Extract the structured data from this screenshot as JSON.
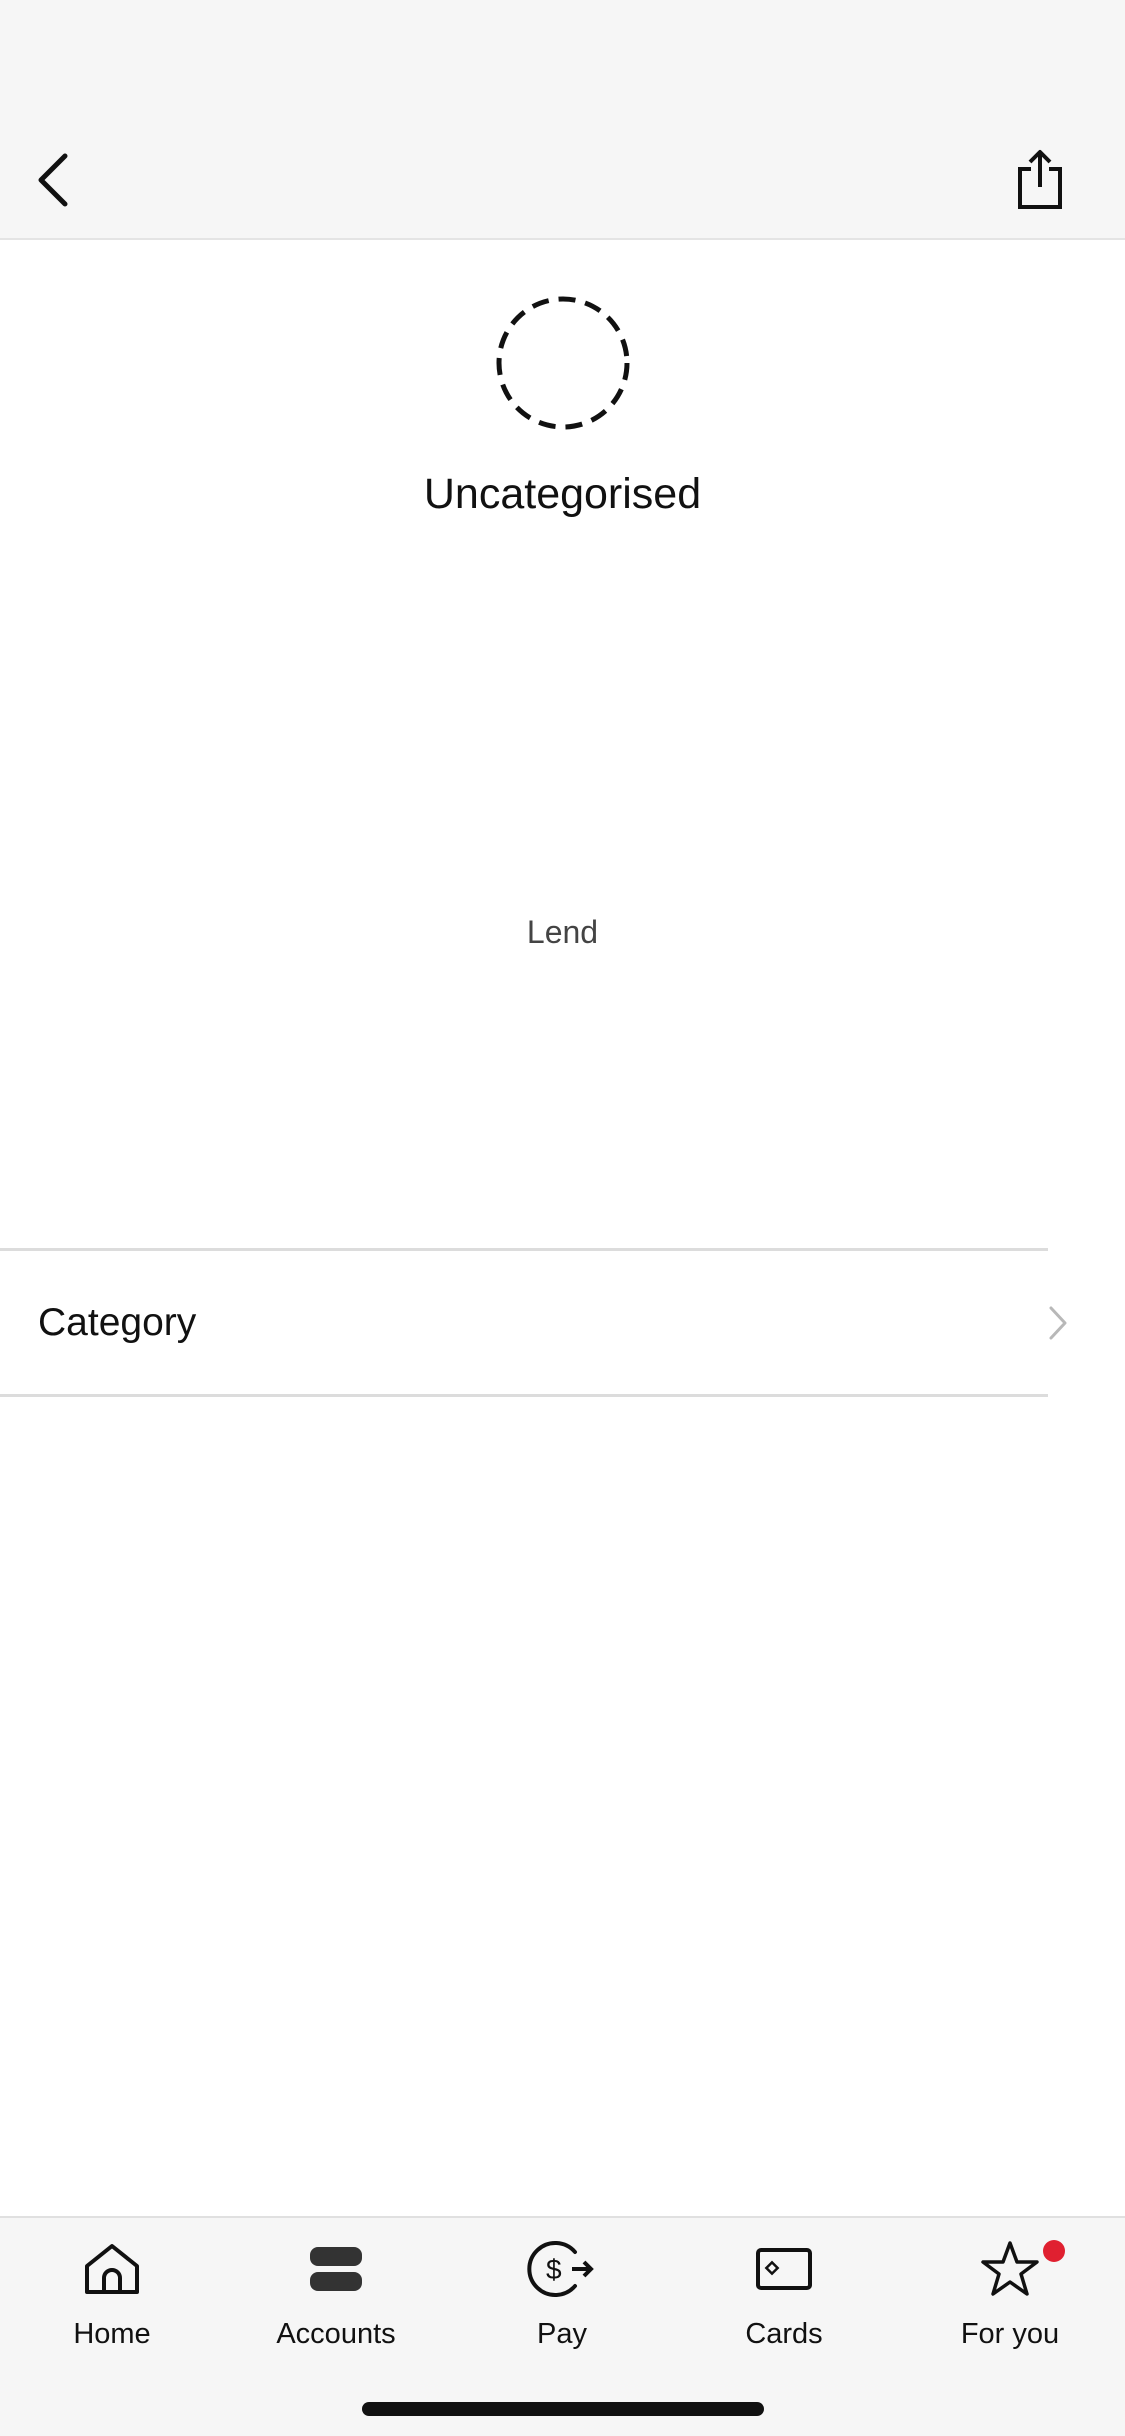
{
  "header": {
    "back_icon": "chevron-left-icon",
    "share_icon": "share-icon"
  },
  "category": {
    "icon": "dashed-circle-icon",
    "title": "Uncategorised",
    "subtext": "Lend"
  },
  "details": {
    "category_row_label": "Category",
    "category_row_icon": "chevron-right-icon"
  },
  "tabbar": {
    "tabs": [
      {
        "label": "Home",
        "icon": "home-icon"
      },
      {
        "label": "Accounts",
        "icon": "accounts-icon"
      },
      {
        "label": "Pay",
        "icon": "pay-icon"
      },
      {
        "label": "Cards",
        "icon": "card-icon"
      },
      {
        "label": "For you",
        "icon": "star-icon"
      }
    ],
    "notification_color": "#e02030"
  }
}
